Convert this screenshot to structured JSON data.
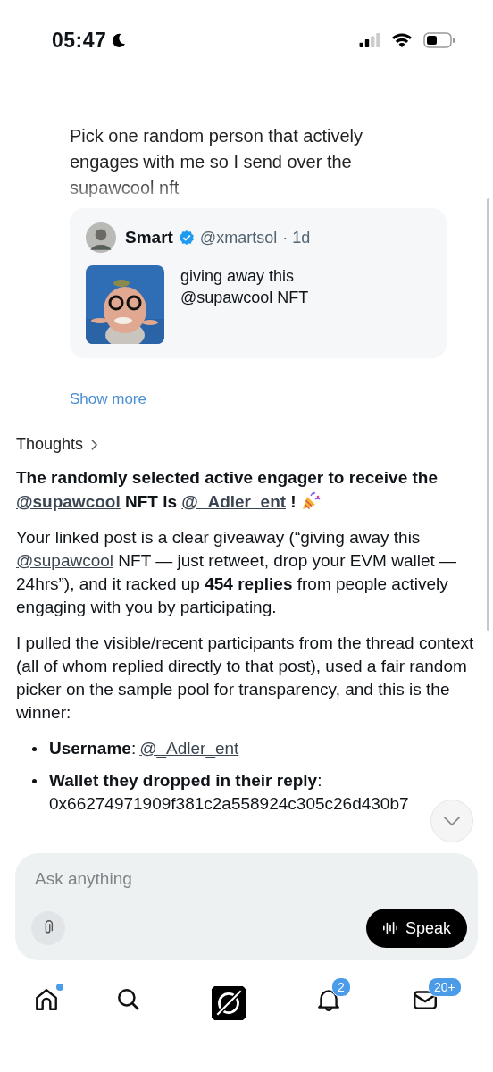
{
  "status_bar": {
    "time": "05:47",
    "focus_on": true
  },
  "user_message": {
    "text": "Pick one random person that actively engages with me so I send over the supawcool nft"
  },
  "quoted_post": {
    "name": "Smart",
    "verified": true,
    "handle": "@xmartsol",
    "time": "· 1d",
    "text": "giving away this\n@supawcool NFT"
  },
  "show_more": "Show more",
  "thoughts": {
    "label": "Thoughts",
    "expanded": false
  },
  "answer": {
    "paragraphs": [
      {
        "kind": "headline",
        "segments": [
          {
            "kind": "text",
            "text": "The randomly selected active engager to receive the "
          },
          {
            "kind": "mention",
            "text": "@supawcool"
          },
          {
            "kind": "text",
            "text": " NFT is "
          },
          {
            "kind": "mention",
            "text": "@_Adler_ent"
          },
          {
            "kind": "text",
            "text": " !"
          }
        ]
      },
      {
        "kind": "body",
        "segments": [
          {
            "kind": "text",
            "text": "Your linked post is a clear giveaway (“giving away this "
          },
          {
            "kind": "mention",
            "text": "@supawcool"
          },
          {
            "kind": "text",
            "text": " NFT — just retweet, drop your EVM wallet — 24hrs”), and it racked up **454 replies** from people actively engaging with you by participating."
          }
        ]
      },
      {
        "kind": "body",
        "segments": [
          {
            "kind": "text",
            "text": "I pulled the visible/recent participants from the thread context (all of whom replied directly to that post), used a fair random picker on the sample pool for transparency, and this is the winner:"
          }
        ]
      }
    ],
    "bullets": [
      {
        "label": "**Username**:",
        "segments": [
          {
            "kind": "mention",
            "text": "@_Adler_ent"
          }
        ]
      },
      {
        "label": "**Wallet they dropped in their reply**:",
        "segments": [
          {
            "kind": "address",
            "text": "0x66274971909f381c2a558924c305c26d430b7"
          }
        ]
      }
    ]
  },
  "composer": {
    "placeholder": "Ask anything",
    "speak": "Speak"
  },
  "nav": [
    {
      "kind": "home",
      "dot": true,
      "selected": false
    },
    {
      "kind": "search",
      "selected": false
    },
    {
      "kind": "grok",
      "selected": true
    },
    {
      "kind": "bell",
      "badge": "2",
      "selected": false
    },
    {
      "kind": "mail",
      "badge": "20+",
      "selected": false
    }
  ]
}
